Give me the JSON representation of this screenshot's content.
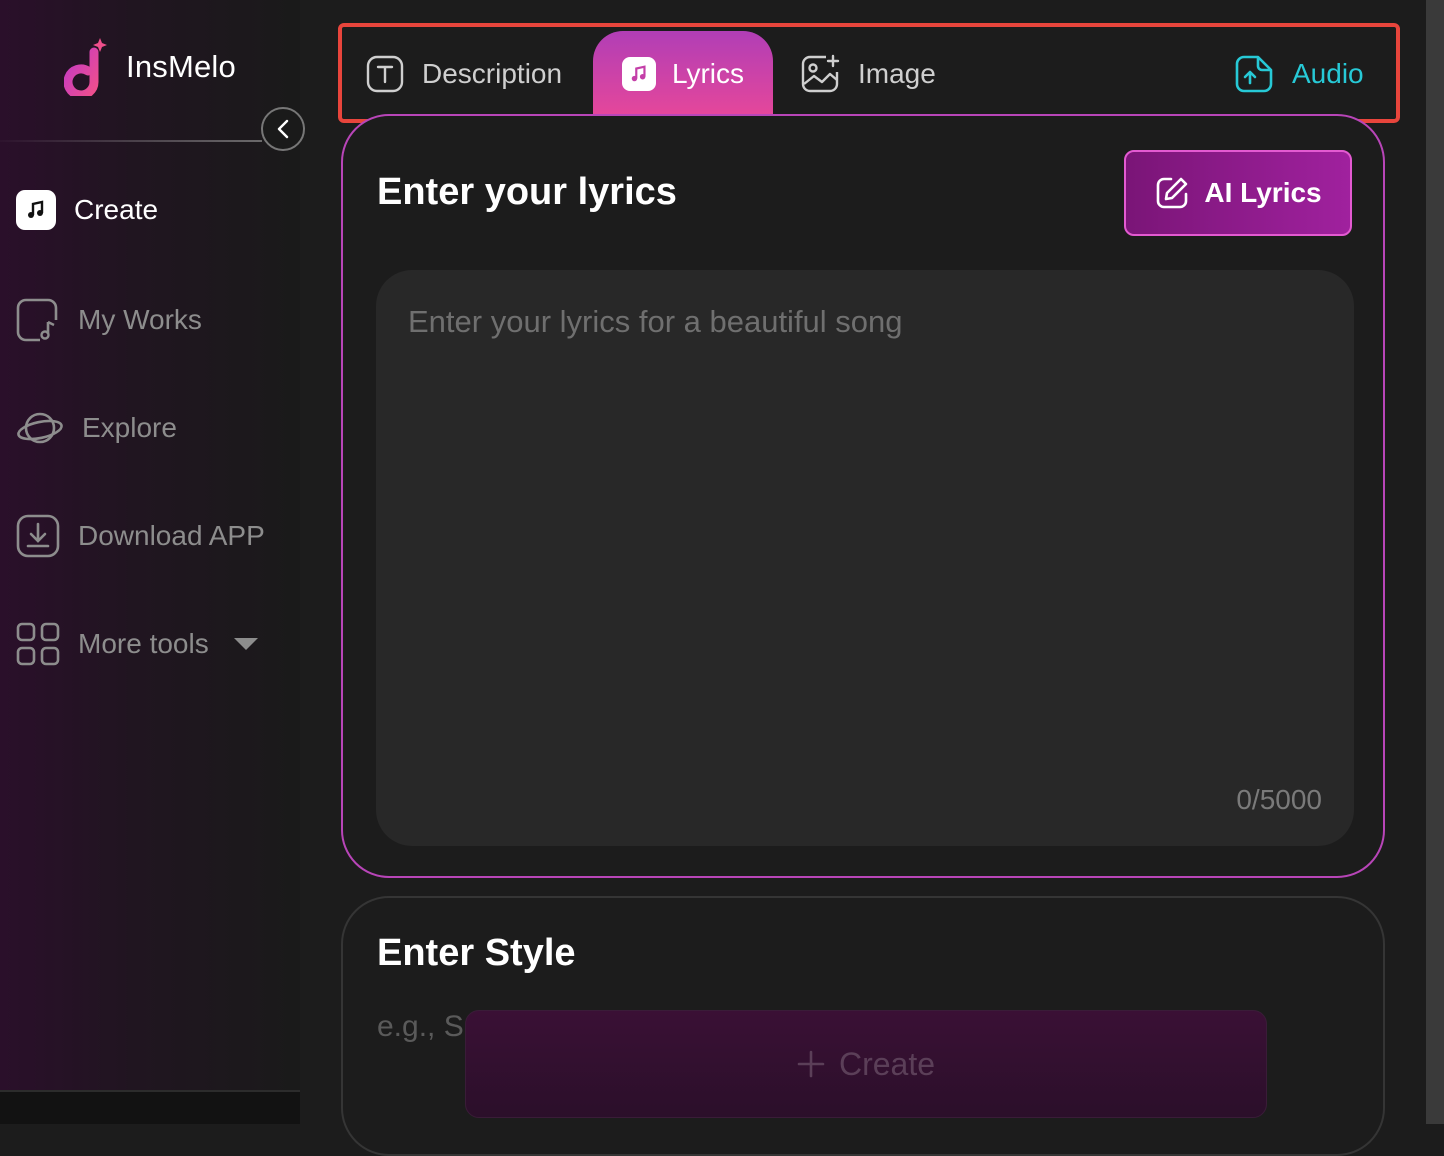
{
  "app": {
    "name": "InsMelo"
  },
  "sidebar": {
    "items": [
      {
        "label": "Create",
        "icon": "music-note-icon",
        "active": true
      },
      {
        "label": "My Works",
        "icon": "document-music-icon"
      },
      {
        "label": "Explore",
        "icon": "planet-icon"
      },
      {
        "label": "Download APP",
        "icon": "download-icon"
      },
      {
        "label": "More tools",
        "icon": "grid-icon"
      }
    ]
  },
  "tabs": {
    "description": "Description",
    "lyrics": "Lyrics",
    "image": "Image",
    "audio": "Audio",
    "selected": "Lyrics"
  },
  "lyrics_section": {
    "title": "Enter your lyrics",
    "ai_button": "AI Lyrics",
    "placeholder": "Enter your lyrics for a beautiful song",
    "char_count": "0/5000"
  },
  "style_section": {
    "title": "Enter Style",
    "placeholder": "e.g., S",
    "create_button": "Create"
  },
  "colors": {
    "accent_pink": "#e6479a",
    "accent_purple": "#b845b8",
    "audio_cyan": "#27c9d6",
    "highlight_red": "#e8453c"
  }
}
